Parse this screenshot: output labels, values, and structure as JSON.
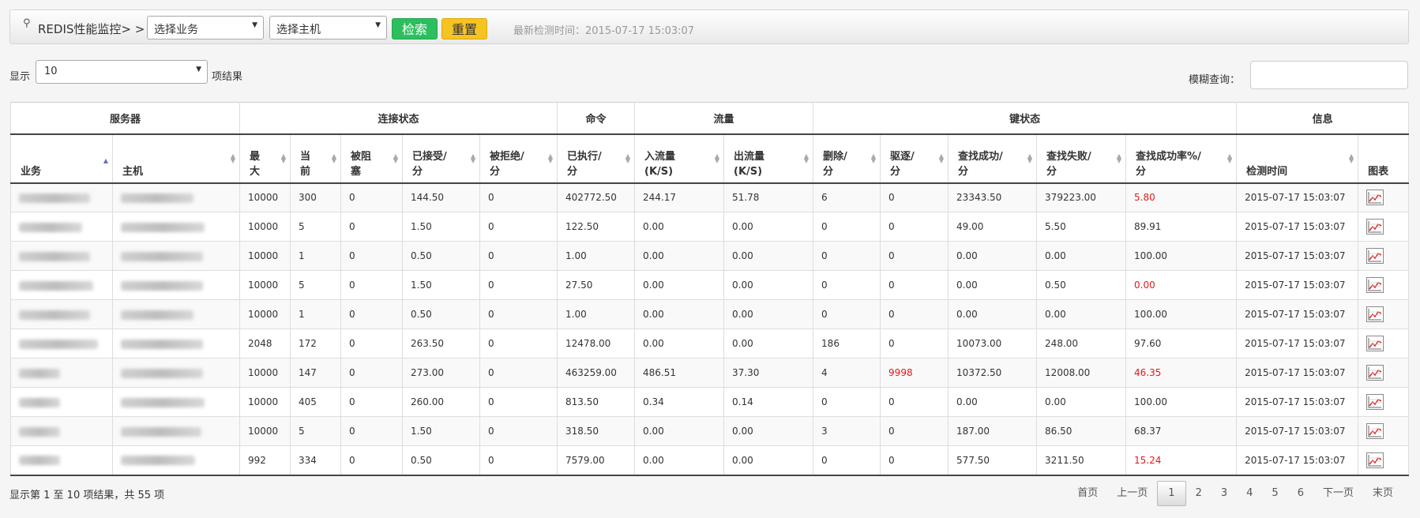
{
  "toolbar": {
    "title": "REDIS性能监控> >",
    "business_select": "选择业务",
    "host_select": "选择主机",
    "search_label": "检索",
    "reset_label": "重置",
    "last_check": "最新检测时间：2015-07-17 15:03:07"
  },
  "length": {
    "label": "显示",
    "value": "10",
    "after": "项结果"
  },
  "filter": {
    "label": "模糊查询：",
    "value": ""
  },
  "groups": [
    "服务器",
    "连接状态",
    "命令",
    "流量",
    "键状态",
    "信息"
  ],
  "columns": [
    {
      "line1": "业务",
      "line2": ""
    },
    {
      "line1": "主机",
      "line2": ""
    },
    {
      "line1": "最",
      "line2": "大"
    },
    {
      "line1": "当",
      "line2": "前"
    },
    {
      "line1": "被阻",
      "line2": "塞"
    },
    {
      "line1": "已接受/",
      "line2": "分"
    },
    {
      "line1": "被拒绝/",
      "line2": "分"
    },
    {
      "line1": "已执行/",
      "line2": "分"
    },
    {
      "line1": "入流量",
      "line2": "(K/S)"
    },
    {
      "line1": "出流量",
      "line2": "(K/S)"
    },
    {
      "line1": "删除/",
      "line2": "分"
    },
    {
      "line1": "驱逐/",
      "line2": "分"
    },
    {
      "line1": "查找成功/",
      "line2": "分"
    },
    {
      "line1": "查找失败/",
      "line2": "分"
    },
    {
      "line1": "查找成功率%/",
      "line2": "分"
    },
    {
      "line1": "检测时间",
      "line2": ""
    },
    {
      "line1": "图表",
      "line2": ""
    }
  ],
  "rows": [
    {
      "max": "10000",
      "cur": "300",
      "blocked": "0",
      "accepted": "144.50",
      "rejected": "0",
      "executed": "402772.50",
      "in": "244.17",
      "out": "51.78",
      "del": "6",
      "evict": "0",
      "hit": "23343.50",
      "miss": "379223.00",
      "rate": "5.80",
      "time": "2015-07-17 15:03:07"
    },
    {
      "max": "10000",
      "cur": "5",
      "blocked": "0",
      "accepted": "1.50",
      "rejected": "0",
      "executed": "122.50",
      "in": "0.00",
      "out": "0.00",
      "del": "0",
      "evict": "0",
      "hit": "49.00",
      "miss": "5.50",
      "rate": "89.91",
      "time": "2015-07-17 15:03:07"
    },
    {
      "max": "10000",
      "cur": "1",
      "blocked": "0",
      "accepted": "0.50",
      "rejected": "0",
      "executed": "1.00",
      "in": "0.00",
      "out": "0.00",
      "del": "0",
      "evict": "0",
      "hit": "0.00",
      "miss": "0.00",
      "rate": "100.00",
      "time": "2015-07-17 15:03:07"
    },
    {
      "max": "10000",
      "cur": "5",
      "blocked": "0",
      "accepted": "1.50",
      "rejected": "0",
      "executed": "27.50",
      "in": "0.00",
      "out": "0.00",
      "del": "0",
      "evict": "0",
      "hit": "0.00",
      "miss": "0.50",
      "rate": "0.00",
      "time": "2015-07-17 15:03:07"
    },
    {
      "max": "10000",
      "cur": "1",
      "blocked": "0",
      "accepted": "0.50",
      "rejected": "0",
      "executed": "1.00",
      "in": "0.00",
      "out": "0.00",
      "del": "0",
      "evict": "0",
      "hit": "0.00",
      "miss": "0.00",
      "rate": "100.00",
      "time": "2015-07-17 15:03:07"
    },
    {
      "max": "2048",
      "cur": "172",
      "blocked": "0",
      "accepted": "263.50",
      "rejected": "0",
      "executed": "12478.00",
      "in": "0.00",
      "out": "0.00",
      "del": "186",
      "evict": "0",
      "hit": "10073.00",
      "miss": "248.00",
      "rate": "97.60",
      "time": "2015-07-17 15:03:07"
    },
    {
      "max": "10000",
      "cur": "147",
      "blocked": "0",
      "accepted": "273.00",
      "rejected": "0",
      "executed": "463259.00",
      "in": "486.51",
      "out": "37.30",
      "del": "4",
      "evict": "9998",
      "hit": "10372.50",
      "miss": "12008.00",
      "rate": "46.35",
      "time": "2015-07-17 15:03:07"
    },
    {
      "max": "10000",
      "cur": "405",
      "blocked": "0",
      "accepted": "260.00",
      "rejected": "0",
      "executed": "813.50",
      "in": "0.34",
      "out": "0.14",
      "del": "0",
      "evict": "0",
      "hit": "0.00",
      "miss": "0.00",
      "rate": "100.00",
      "time": "2015-07-17 15:03:07"
    },
    {
      "max": "10000",
      "cur": "5",
      "blocked": "0",
      "accepted": "1.50",
      "rejected": "0",
      "executed": "318.50",
      "in": "0.00",
      "out": "0.00",
      "del": "3",
      "evict": "0",
      "hit": "187.00",
      "miss": "86.50",
      "rate": "68.37",
      "time": "2015-07-17 15:03:07"
    },
    {
      "max": "992",
      "cur": "334",
      "blocked": "0",
      "accepted": "0.50",
      "rejected": "0",
      "executed": "7579.00",
      "in": "0.00",
      "out": "0.00",
      "del": "0",
      "evict": "0",
      "hit": "577.50",
      "miss": "3211.50",
      "rate": "15.24",
      "time": "2015-07-17 15:03:07"
    }
  ],
  "info": "显示第 1 至 10 项结果，共 55 项",
  "pager": {
    "first": "首页",
    "prev": "上一页",
    "pages": [
      "1",
      "2",
      "3",
      "4",
      "5",
      "6"
    ],
    "next": "下一页",
    "last": "末页"
  },
  "colors": {
    "search": "#2dbf5e",
    "reset": "#f5c322",
    "alert": "#e21b1b"
  }
}
